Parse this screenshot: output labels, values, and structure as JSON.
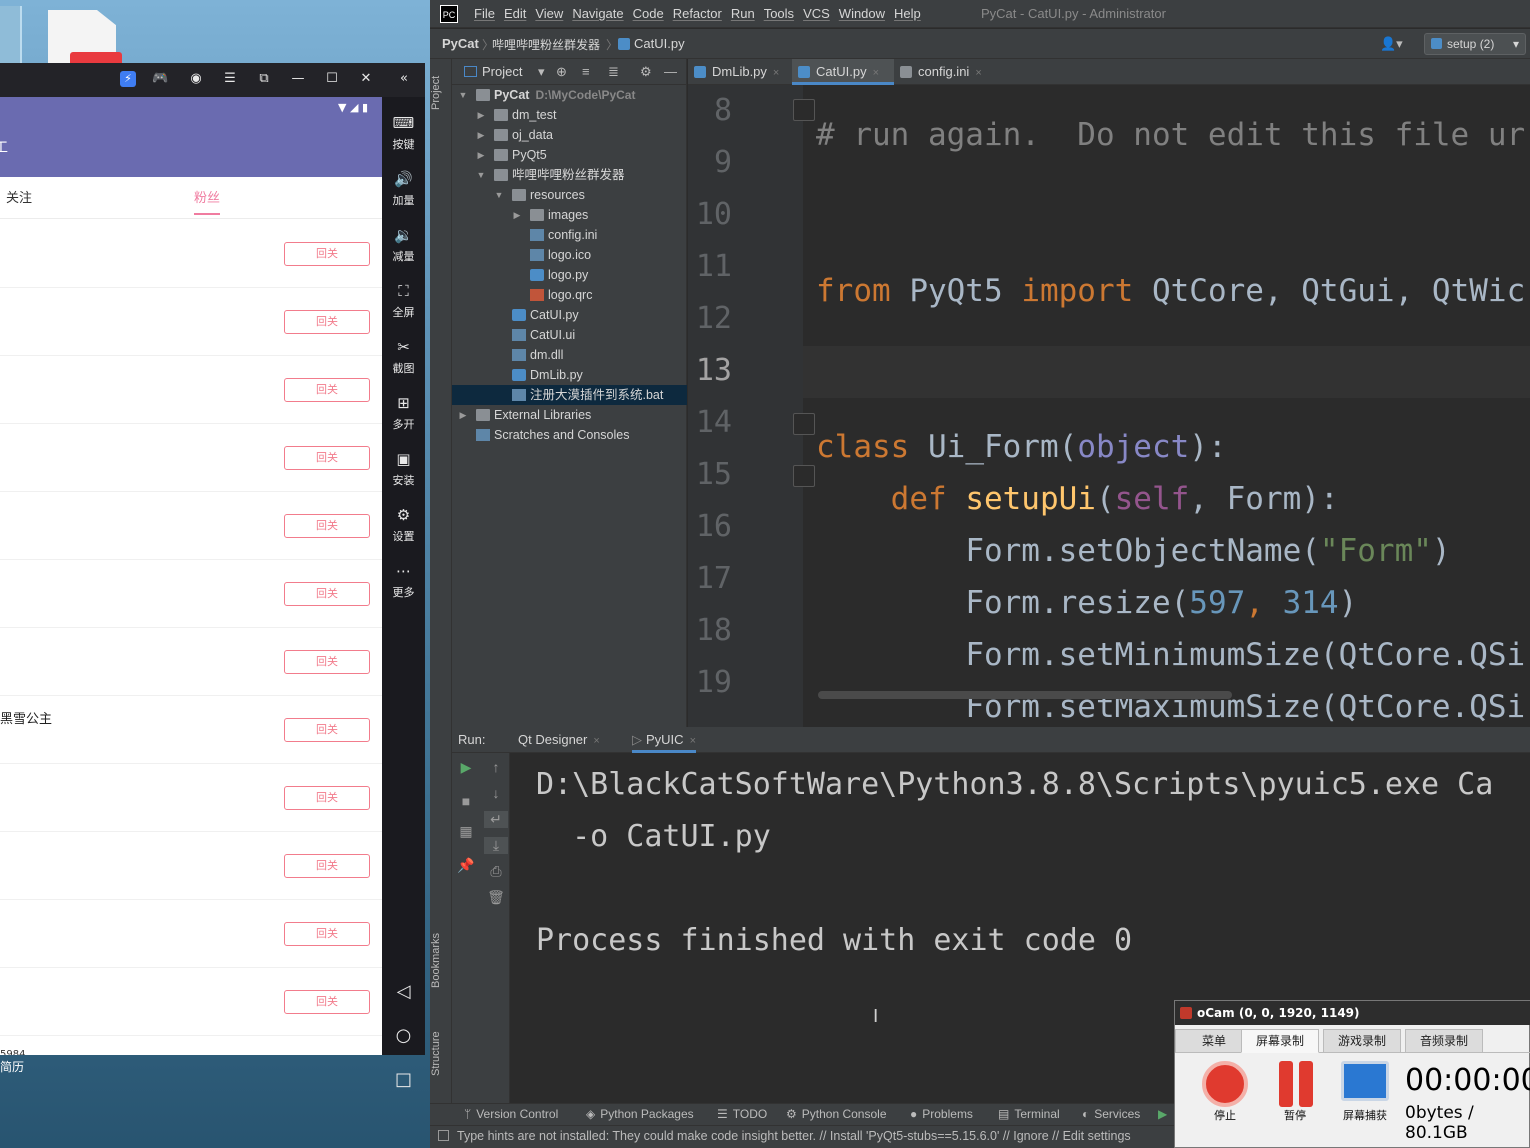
{
  "emulator": {
    "sidebar": [
      {
        "icon": "keyboard-icon",
        "label": "按键"
      },
      {
        "icon": "volume-up-icon",
        "label": "加量"
      },
      {
        "icon": "volume-down-icon",
        "label": "减量"
      },
      {
        "icon": "fullscreen-icon",
        "label": "全屏"
      },
      {
        "icon": "scissors-icon",
        "label": "截图"
      },
      {
        "icon": "multi-instance-icon",
        "label": "多开"
      },
      {
        "icon": "apk-install-icon",
        "label": "安装"
      },
      {
        "icon": "settings-icon",
        "label": "设置"
      },
      {
        "icon": "more-icon",
        "label": "更多"
      }
    ],
    "phone": {
      "title_fragment": "工",
      "tab_follow": "关注",
      "tab_fans": "粉丝",
      "row_button": "回关",
      "row_count": 12,
      "named_row": "黑雪公主",
      "bottom_text": "5984"
    },
    "desktop_label": "简历"
  },
  "ide": {
    "menu": [
      "File",
      "Edit",
      "View",
      "Navigate",
      "Code",
      "Refactor",
      "Run",
      "Tools",
      "VCS",
      "Window",
      "Help"
    ],
    "window_title": "PyCat - CatUI.py - Administrator",
    "breadcrumb": [
      "PyCat",
      "哔哩哔哩粉丝群发器",
      "CatUI.py"
    ],
    "run_config": "setup (2)",
    "side_labels": {
      "project": "Project",
      "bookmarks": "Bookmarks",
      "structure": "Structure"
    },
    "project_panel_title": "Project",
    "tree": [
      {
        "label": "PyCat",
        "path": "D:\\MyCode\\PyCat",
        "depth": 0,
        "type": "folder",
        "open": true,
        "bold": true
      },
      {
        "label": "dm_test",
        "depth": 1,
        "type": "folder",
        "open": false
      },
      {
        "label": "oj_data",
        "depth": 1,
        "type": "folder",
        "open": false
      },
      {
        "label": "PyQt5",
        "depth": 1,
        "type": "folder",
        "open": false
      },
      {
        "label": "哔哩哔哩粉丝群发器",
        "depth": 1,
        "type": "folder",
        "open": true
      },
      {
        "label": "resources",
        "depth": 2,
        "type": "folder",
        "open": true
      },
      {
        "label": "images",
        "depth": 3,
        "type": "folder",
        "open": false
      },
      {
        "label": "config.ini",
        "depth": 3,
        "type": "file"
      },
      {
        "label": "logo.ico",
        "depth": 3,
        "type": "file"
      },
      {
        "label": "logo.py",
        "depth": 3,
        "type": "py"
      },
      {
        "label": "logo.qrc",
        "depth": 3,
        "type": "qrc"
      },
      {
        "label": "CatUI.py",
        "depth": 2,
        "type": "py"
      },
      {
        "label": "CatUI.ui",
        "depth": 2,
        "type": "file"
      },
      {
        "label": "dm.dll",
        "depth": 2,
        "type": "file"
      },
      {
        "label": "DmLib.py",
        "depth": 2,
        "type": "py"
      },
      {
        "label": "注册大漠插件到系统.bat",
        "depth": 2,
        "type": "file",
        "selected": true
      },
      {
        "label": "External Libraries",
        "depth": 0,
        "type": "lib",
        "open": false
      },
      {
        "label": "Scratches and Consoles",
        "depth": 0,
        "type": "scratch"
      }
    ],
    "tabs": [
      {
        "label": "DmLib.py",
        "active": false
      },
      {
        "label": "CatUI.py",
        "active": true
      },
      {
        "label": "config.ini",
        "active": false
      }
    ],
    "line_numbers": [
      "8",
      "9",
      "10",
      "11",
      "12",
      "13",
      "14",
      "15",
      "16",
      "17",
      "18",
      "19"
    ],
    "current_line": "13",
    "code": {
      "l8": "# run again.  Do not edit this file ur",
      "l11_from": "from",
      "l11_mod": " PyQt5 ",
      "l11_import": "import",
      "l11_rest": " QtCore, QtGui, QtWic",
      "l14_class": "class",
      "l14_name": " Ui_Form(",
      "l14_obj": "object",
      "l14_end": "):",
      "l15_def": "def",
      "l15_fn": " setupUi",
      "l15_p1": "(",
      "l15_self": "self",
      "l15_p2": ", Form):",
      "l16_a": "Form.setObjectName(",
      "l16_str": "\"Form\"",
      "l16_b": ")",
      "l17_a": "Form.resize(",
      "l17_n1": "597",
      "l17_c": ", ",
      "l17_n2": "314",
      "l17_b": ")",
      "l18": "Form.setMinimumSize(QtCore.QSi",
      "l19": "Form.setMaximumSize(QtCore.QSi"
    },
    "run": {
      "label": "Run:",
      "tabs": [
        "Qt Designer",
        "PyUIC"
      ],
      "output_1": "D:\\BlackCatSoftWare\\Python3.8.8\\Scripts\\pyuic5.exe Ca",
      "output_2": "  -o CatUI.py",
      "output_3": "Process finished with exit code 0"
    },
    "statusbar": [
      "Version Control",
      "Python Packages",
      "TODO",
      "Python Console",
      "Problems",
      "Terminal",
      "Services"
    ],
    "message": "Type hints are not installed: They could make code insight better. // Install 'PyQt5-stubs==5.15.6.0' // Ignore // Edit settings"
  },
  "ocam": {
    "title": "oCam (0, 0, 1920, 1149)",
    "tabs": [
      "菜单",
      "屏幕录制",
      "游戏录制",
      "音频录制"
    ],
    "buttons": [
      "停止",
      "暂停",
      "屏幕捕获"
    ],
    "time": "00:00:00",
    "size": "0bytes / 80.1GB"
  }
}
